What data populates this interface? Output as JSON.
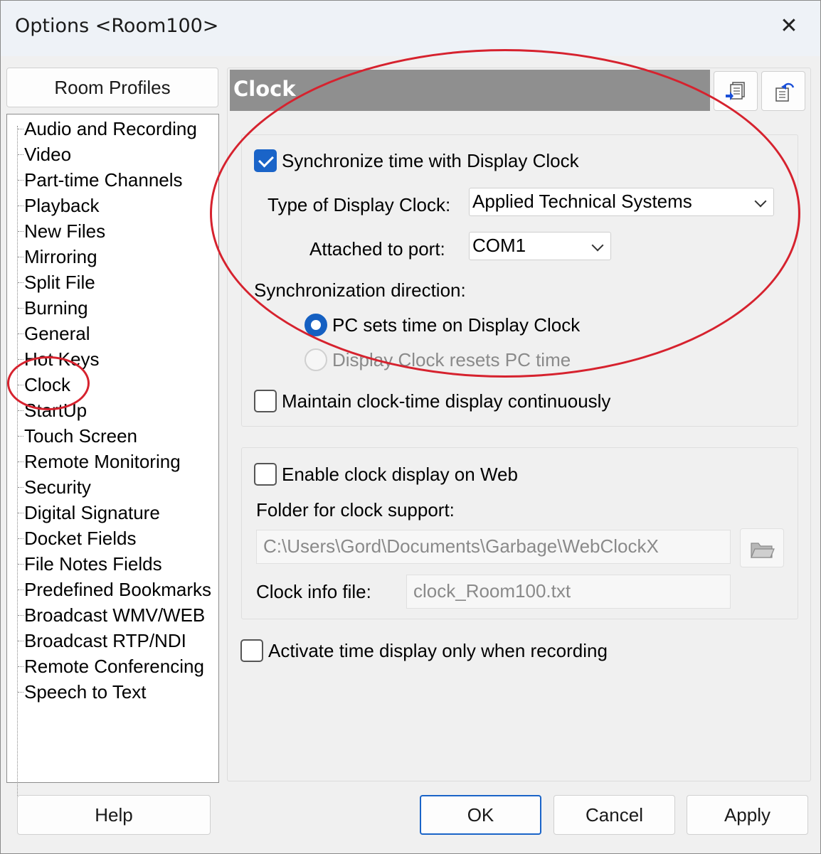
{
  "window": {
    "title": "Options <Room100>",
    "close_icon": "close-icon"
  },
  "sidebar": {
    "room_profiles_label": "Room Profiles",
    "items": [
      "Audio and Recording",
      "Video",
      "Part-time Channels",
      "Playback",
      "New Files",
      "Mirroring",
      "Split File",
      "Burning",
      "General",
      "Hot Keys",
      "Clock",
      "StartUp",
      "Touch Screen",
      "Remote Monitoring",
      "Security",
      "Digital Signature",
      "Docket Fields",
      "File Notes Fields",
      "Predefined Bookmarks",
      "Broadcast WMV/WEB",
      "Broadcast RTP/NDI",
      "Remote Conferencing",
      "Speech to Text"
    ],
    "selected": "Clock"
  },
  "panel": {
    "title": "Clock",
    "icons": [
      "copy-settings-icon",
      "restore-settings-icon"
    ],
    "sync": {
      "checkbox_label": "Synchronize time with Display Clock",
      "checked": true,
      "type_label": "Type of Display Clock:",
      "type_value": "Applied Technical Systems",
      "port_label": "Attached to port:",
      "port_value": "COM1",
      "direction_label": "Synchronization direction:",
      "radio_pc_label": "PC sets time on Display Clock",
      "radio_clock_label": "Display Clock resets PC time",
      "maintain_label": "Maintain clock-time display continuously",
      "maintain_checked": false
    },
    "web": {
      "checkbox_label": "Enable clock display on Web",
      "checked": false,
      "folder_label": "Folder for clock support:",
      "folder_value": "C:\\Users\\Gord\\Documents\\Garbage\\WebClockX",
      "info_label": "Clock info file:",
      "info_value": "clock_Room100.txt"
    },
    "activate_label": "Activate time display only when recording",
    "activate_checked": false
  },
  "footer": {
    "help": "Help",
    "ok": "OK",
    "cancel": "Cancel",
    "apply": "Apply"
  },
  "colors": {
    "accent": "#1a64c8",
    "header_bar": "#8f8f8f",
    "annotation": "#d6222e"
  }
}
